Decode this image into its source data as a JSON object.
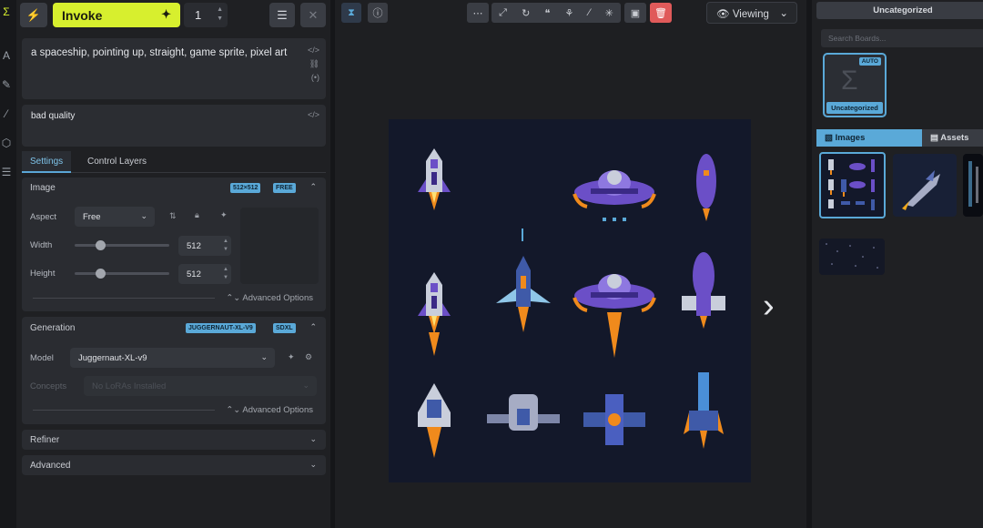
{
  "toolbar": {
    "invoke_label": "Invoke",
    "iterations": "1"
  },
  "prompts": {
    "positive": "a spaceship, pointing up, straight, game sprite, pixel art",
    "negative": "bad quality"
  },
  "tabs": [
    "Settings",
    "Control Layers"
  ],
  "image_section": {
    "title": "Image",
    "badges": [
      "512×512",
      "FREE"
    ],
    "aspect_label": "Aspect",
    "aspect_value": "Free",
    "width_label": "Width",
    "width_value": "512",
    "width_fraction": 0.27,
    "height_label": "Height",
    "height_value": "512",
    "height_fraction": 0.27,
    "advanced_label": "Advanced Options"
  },
  "generation_section": {
    "title": "Generation",
    "badges": [
      "JUGGERNAUT-XL-V9",
      "SDXL"
    ],
    "model_label": "Model",
    "model_value": "Juggernaut-XL-v9",
    "concepts_label": "Concepts",
    "concepts_placeholder": "No LoRAs Installed",
    "advanced_label": "Advanced Options"
  },
  "collapsed_sections": [
    "Refiner",
    "Advanced"
  ],
  "viewer": {
    "viewing_label": "Viewing"
  },
  "gallery": {
    "header": "Uncategorized",
    "search_placeholder": "Search Boards...",
    "board_badge": "AUTO",
    "board_name": "Uncategorized",
    "tab_images": "Images",
    "tab_assets": "Assets"
  },
  "colors": {
    "invoke": "#d7ef2e",
    "accent": "#5aa9d8",
    "delete": "#e05a5a",
    "ship_purple": "#6b4fc7",
    "flame": "#f08a1c"
  }
}
